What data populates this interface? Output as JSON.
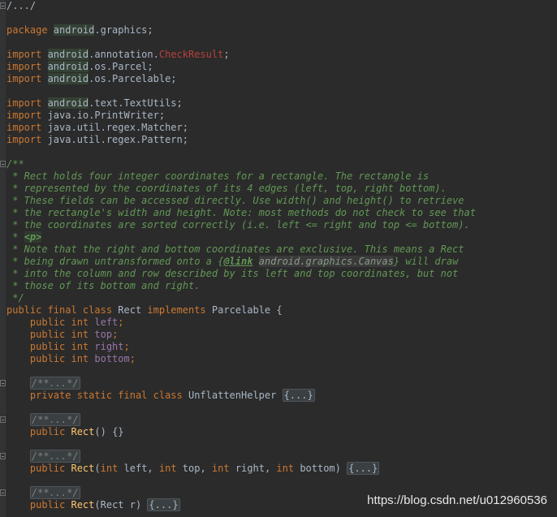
{
  "editor": {
    "lines": [
      [
        {
          "t": "/.../",
          "c": "plain"
        }
      ],
      [],
      [
        {
          "t": "package ",
          "c": "kw"
        },
        {
          "t": "android",
          "c": "pkg"
        },
        {
          "t": ".graphics;",
          "c": "plain"
        }
      ],
      [],
      [
        {
          "t": "import ",
          "c": "kw"
        },
        {
          "t": "android",
          "c": "pkg"
        },
        {
          "t": ".annotation.",
          "c": "plain"
        },
        {
          "t": "CheckResult",
          "c": "err"
        },
        {
          "t": ";",
          "c": "plain"
        }
      ],
      [
        {
          "t": "import ",
          "c": "kw"
        },
        {
          "t": "android",
          "c": "pkg"
        },
        {
          "t": ".os.Parcel;",
          "c": "plain"
        }
      ],
      [
        {
          "t": "import ",
          "c": "kw"
        },
        {
          "t": "android",
          "c": "pkg"
        },
        {
          "t": ".os.Parcelable;",
          "c": "plain"
        }
      ],
      [],
      [
        {
          "t": "import ",
          "c": "kw"
        },
        {
          "t": "android",
          "c": "pkg"
        },
        {
          "t": ".text.TextUtils;",
          "c": "plain"
        }
      ],
      [
        {
          "t": "import ",
          "c": "kw"
        },
        {
          "t": "java.io.PrintWriter;",
          "c": "plain"
        }
      ],
      [
        {
          "t": "import ",
          "c": "kw"
        },
        {
          "t": "java.util.regex.Matcher;",
          "c": "plain"
        }
      ],
      [
        {
          "t": "import ",
          "c": "kw"
        },
        {
          "t": "java.util.regex.Pattern;",
          "c": "plain"
        }
      ],
      [],
      [
        {
          "t": "/**",
          "c": "doc"
        }
      ],
      [
        {
          "t": " * Rect holds four integer coordinates for a rectangle. The rectangle is",
          "c": "doc"
        }
      ],
      [
        {
          "t": " * represented by the coordinates of its 4 edges (left, top, right bottom).",
          "c": "doc"
        }
      ],
      [
        {
          "t": " * These fields can be accessed directly. Use width() and height() to retrieve",
          "c": "doc"
        }
      ],
      [
        {
          "t": " * the rectangle's width and height. Note: most methods do not check to see that",
          "c": "doc"
        }
      ],
      [
        {
          "t": " * the coordinates are sorted correctly (i.e. left <= right and top <= bottom).",
          "c": "doc"
        }
      ],
      [
        {
          "t": " * ",
          "c": "doc"
        },
        {
          "t": "<p>",
          "c": "tag"
        }
      ],
      [
        {
          "t": " * Note that the right and bottom coordinates are exclusive. This means a Rect",
          "c": "doc"
        }
      ],
      [
        {
          "t": " * being drawn untransformed onto a {",
          "c": "doc"
        },
        {
          "t": "@link",
          "c": "lnk"
        },
        {
          "t": " ",
          "c": "doc"
        },
        {
          "t": "android.graphics.Canvas",
          "c": "ref"
        },
        {
          "t": "} will draw",
          "c": "doc"
        }
      ],
      [
        {
          "t": " * into the column and row described by its left and top coordinates, but not",
          "c": "doc"
        }
      ],
      [
        {
          "t": " * those of its bottom and right.",
          "c": "doc"
        }
      ],
      [
        {
          "t": " */",
          "c": "doc"
        }
      ],
      [
        {
          "t": "public final class ",
          "c": "kw"
        },
        {
          "t": "Rect ",
          "c": "plain"
        },
        {
          "t": "implements ",
          "c": "kw"
        },
        {
          "t": "Parcelable {",
          "c": "plain"
        }
      ],
      [
        {
          "t": "    public int ",
          "c": "kw"
        },
        {
          "t": "left",
          "c": "fld"
        },
        {
          "t": ";",
          "c": "kw"
        }
      ],
      [
        {
          "t": "    public int ",
          "c": "kw"
        },
        {
          "t": "top",
          "c": "fld"
        },
        {
          "t": ";",
          "c": "kw"
        }
      ],
      [
        {
          "t": "    public int ",
          "c": "kw"
        },
        {
          "t": "right",
          "c": "fld"
        },
        {
          "t": ";",
          "c": "kw"
        }
      ],
      [
        {
          "t": "    public int ",
          "c": "kw"
        },
        {
          "t": "bottom",
          "c": "fld"
        },
        {
          "t": ";",
          "c": "kw"
        }
      ],
      [],
      [
        {
          "t": "    ",
          "c": "plain"
        },
        {
          "t": "/**...*/",
          "c": "collapsed-doc"
        }
      ],
      [
        {
          "t": "    private static final class ",
          "c": "kw"
        },
        {
          "t": "UnflattenHelper ",
          "c": "plain"
        },
        {
          "t": "{...}",
          "c": "collapsed"
        }
      ],
      [],
      [
        {
          "t": "    ",
          "c": "plain"
        },
        {
          "t": "/**...*/",
          "c": "collapsed-doc"
        }
      ],
      [
        {
          "t": "    public ",
          "c": "kw"
        },
        {
          "t": "Rect",
          "c": "fn"
        },
        {
          "t": "() {}",
          "c": "plain"
        }
      ],
      [],
      [
        {
          "t": "    ",
          "c": "plain"
        },
        {
          "t": "/**...*/",
          "c": "collapsed-doc"
        }
      ],
      [
        {
          "t": "    public ",
          "c": "kw"
        },
        {
          "t": "Rect",
          "c": "fn"
        },
        {
          "t": "(",
          "c": "plain"
        },
        {
          "t": "int ",
          "c": "kw"
        },
        {
          "t": "left, ",
          "c": "plain"
        },
        {
          "t": "int ",
          "c": "kw"
        },
        {
          "t": "top, ",
          "c": "plain"
        },
        {
          "t": "int ",
          "c": "kw"
        },
        {
          "t": "right, ",
          "c": "plain"
        },
        {
          "t": "int ",
          "c": "kw"
        },
        {
          "t": "bottom) ",
          "c": "plain"
        },
        {
          "t": "{...}",
          "c": "collapsed"
        }
      ],
      [],
      [
        {
          "t": "    ",
          "c": "plain"
        },
        {
          "t": "/**...*/",
          "c": "collapsed-doc"
        }
      ],
      [
        {
          "t": "    public ",
          "c": "kw"
        },
        {
          "t": "Rect",
          "c": "fn"
        },
        {
          "t": "(Rect r) ",
          "c": "plain"
        },
        {
          "t": "{...}",
          "c": "collapsed"
        }
      ]
    ],
    "fold_markers": [
      0,
      13,
      31,
      34,
      37,
      40
    ]
  },
  "watermark": "https://blog.csdn.net/u012960536"
}
